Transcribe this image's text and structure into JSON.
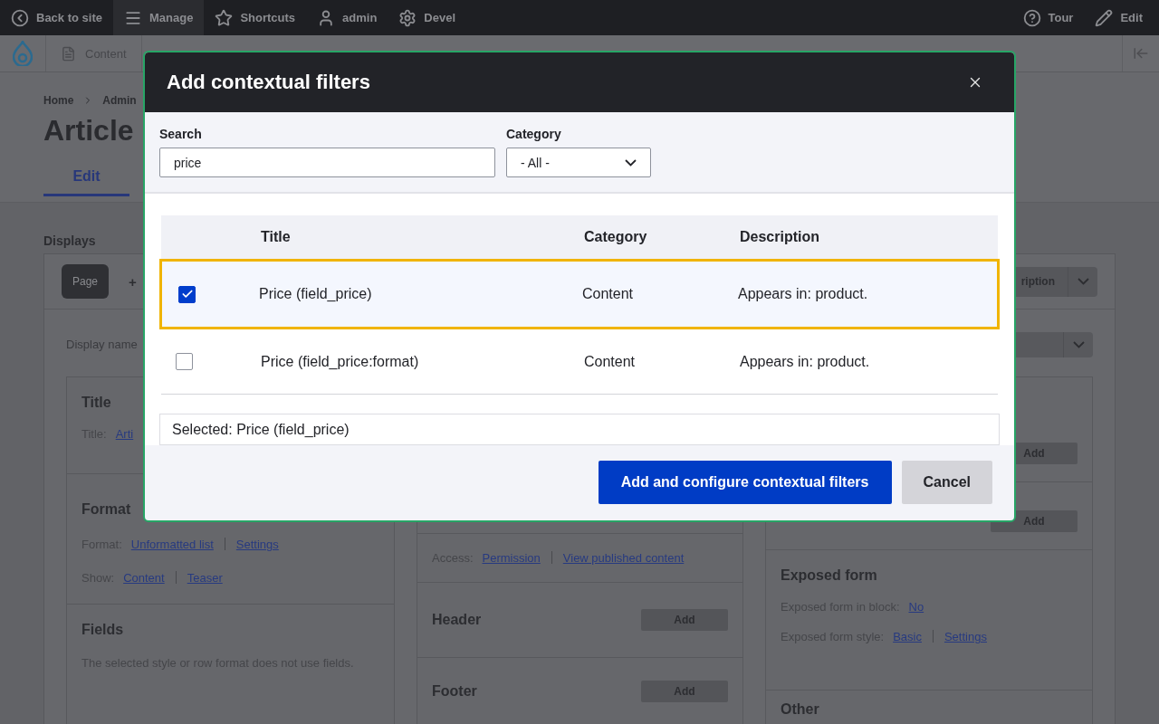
{
  "toolbar": {
    "left": [
      {
        "label": "Back to site",
        "selected": false
      },
      {
        "label": "Manage",
        "selected": true
      },
      {
        "label": "Shortcuts",
        "selected": false
      },
      {
        "label": "admin",
        "selected": false
      },
      {
        "label": "Devel",
        "selected": false
      }
    ],
    "right": [
      {
        "label": "Tour"
      },
      {
        "label": "Edit"
      }
    ]
  },
  "admin_menu": [
    {
      "label": "Content"
    }
  ],
  "breadcrumb": [
    "Home",
    "Admin"
  ],
  "page_title": "Article",
  "tabs": [
    {
      "label": "Edit",
      "selected": true
    }
  ],
  "displays": {
    "heading": "Displays",
    "tabs": [
      {
        "label": "Page",
        "selected": true
      },
      {
        "label": "+",
        "selected": false
      }
    ],
    "menu_button": "ription",
    "display_name_label": "Display name"
  },
  "columns": [
    [
      {
        "heading": "Title",
        "lines": [
          {
            "label": "Title:",
            "links": [
              "Arti"
            ]
          }
        ]
      },
      {
        "heading": "Format",
        "lines": [
          {
            "label": "Format:",
            "links": [
              "Unformatted list",
              "Settings"
            ]
          },
          {
            "label": "Show:",
            "links": [
              "Content",
              "Teaser"
            ]
          }
        ]
      },
      {
        "heading": "Fields",
        "text": "The selected style or row format does not use fields."
      }
    ],
    [
      {
        "kind": "hidden"
      },
      {
        "kind": "lines",
        "lines": [
          {
            "label": "Access:",
            "links": [
              "Permission",
              "View published content"
            ]
          }
        ]
      },
      {
        "kind": "add",
        "heading": "Header",
        "button": "Add"
      },
      {
        "kind": "add",
        "heading": "Footer",
        "button": "Add"
      }
    ],
    [
      {
        "kind": "add",
        "button": "Add"
      },
      {
        "kind": "add",
        "button": "Add"
      },
      {
        "kind": "compact",
        "heading": "Exposed form",
        "lines": [
          {
            "label": "Exposed form in block:",
            "links": [
              "No"
            ]
          },
          {
            "label": "Exposed form style:",
            "links": [
              "Basic",
              "Settings"
            ]
          }
        ]
      },
      {
        "heading": "Other"
      }
    ]
  ],
  "dialog": {
    "title": "Add contextual filters",
    "search": {
      "label": "Search",
      "value": "price"
    },
    "category": {
      "label": "Category",
      "value": "- All -"
    },
    "table": {
      "columns": [
        "Title",
        "Category",
        "Description"
      ],
      "rows": [
        {
          "title": "Price (field_price)",
          "category": "Content",
          "description": "Appears in: product.",
          "checked": true,
          "selected": true
        },
        {
          "title": "Price (field_price:format)",
          "category": "Content",
          "description": "Appears in: product.",
          "checked": false,
          "selected": false
        }
      ]
    },
    "selected_text": "Selected: Price (field_price)",
    "buttons": [
      {
        "label": "Add and configure contextual filters",
        "kind": "primary"
      },
      {
        "label": "Cancel",
        "kind": "secondary"
      }
    ]
  }
}
